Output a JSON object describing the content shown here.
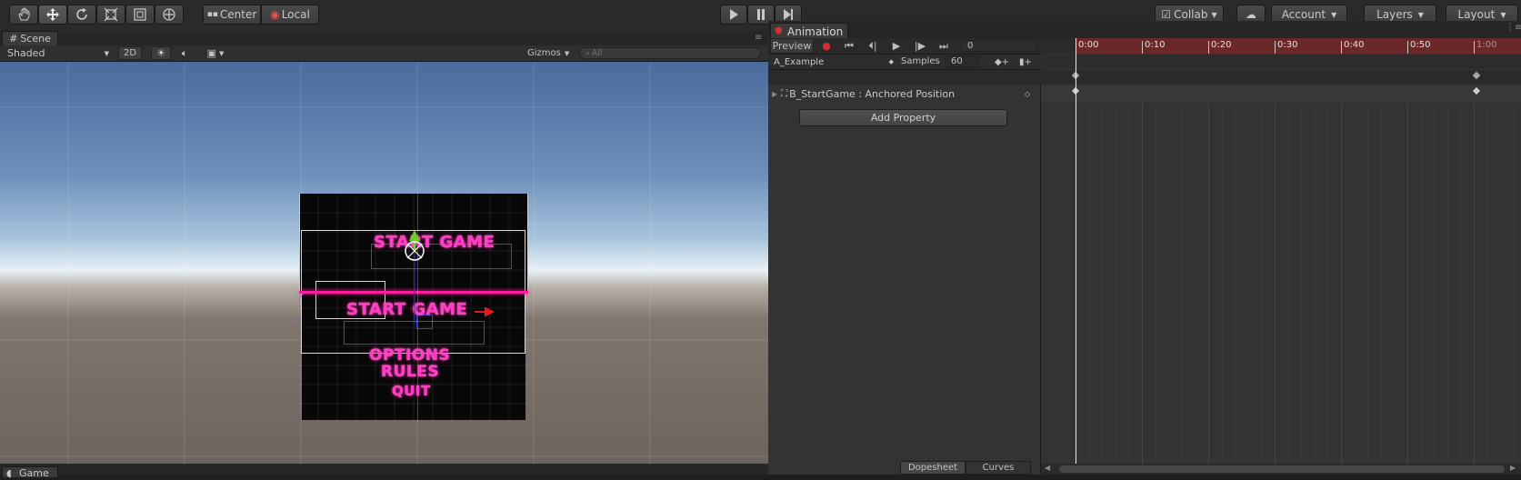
{
  "toolbar": {
    "tools": [
      {
        "name": "hand-tool-icon"
      },
      {
        "name": "move-tool-icon"
      },
      {
        "name": "rotate-tool-icon"
      },
      {
        "name": "scale-tool-icon"
      },
      {
        "name": "rect-tool-icon"
      },
      {
        "name": "transform-tool-icon"
      }
    ],
    "pivot_label": "Center",
    "space_label": "Local",
    "collab_label": "Collab",
    "account_label": "Account",
    "layers_label": "Layers",
    "layout_label": "Layout"
  },
  "scene": {
    "tab_label": "Scene",
    "shading_mode": "Shaded",
    "mode_2d": "2D",
    "gizmos_label": "Gizmos",
    "search_placeholder": "All",
    "menu": {
      "start_game_top": "START GAME",
      "start_game_bottom": "START GAME",
      "options": "OPTIONS",
      "rules": "RULES",
      "quit": "QUIT"
    }
  },
  "game": {
    "tab_label": "Game"
  },
  "animation": {
    "tab_label": "Animation",
    "preview_label": "Preview",
    "frame_value": "0",
    "clip_name": "A_Example",
    "samples_label": "Samples",
    "samples_value": "60",
    "property_label": "B_StartGame : Anchored Position",
    "add_property_label": "Add Property",
    "timeline_ticks": [
      "0:00",
      "0:10",
      "0:20",
      "0:30",
      "0:40",
      "0:50",
      "1:00"
    ],
    "dopesheet_label": "Dopesheet",
    "curves_label": "Curves"
  },
  "colors": {
    "record_red": "#d23030",
    "neon_pink": "#ff3ec8",
    "timeline_red": "#7a2a2a"
  }
}
